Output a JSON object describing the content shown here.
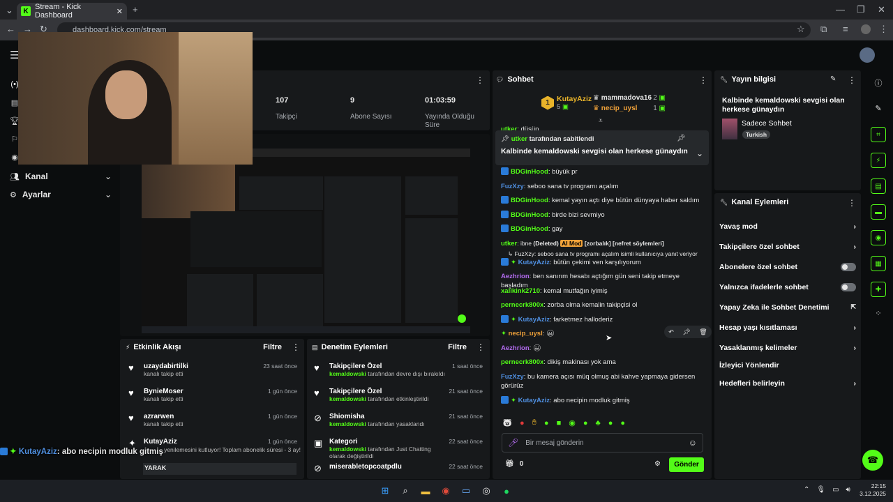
{
  "browser": {
    "tab_title": "Stream - Kick Dashboard",
    "url": "dashboard.kick.com/stream"
  },
  "sidebar": {
    "items": [
      {
        "label": "Kanal"
      },
      {
        "label": "Ayarlar"
      }
    ]
  },
  "stats": [
    {
      "value": "107",
      "label": "Takipçi"
    },
    {
      "value": "9",
      "label": "Abone Sayısı"
    },
    {
      "value": "01:03:59",
      "label": "Yayında Olduğu Süre"
    }
  ],
  "chat": {
    "title": "Sohbet",
    "leaderboard": [
      {
        "rank": "1",
        "name": "KutayAziz",
        "count": "5"
      },
      {
        "name": "mammadova16",
        "count": "2"
      },
      {
        "name": "necip_uysl",
        "count": "1"
      }
    ],
    "partial_user": "utker",
    "partial_text": ": düşüp",
    "pinned_by_user": "utker",
    "pinned_by_suffix": "tarafından sabitlendi",
    "pinned_text": "Kalbinde kemaldowski sevgisi olan herkese günaydın",
    "messages": [
      {
        "user": "BDGinHood",
        "text": ": büyük pr",
        "color": "#53fc18"
      },
      {
        "user": "FuzXzy",
        "text": ": seboo sana tv programı açalım",
        "color": "#4f8fe0"
      },
      {
        "user": "BDGinHood",
        "text": ": kemal yayın açtı diye bütün dünyaya haber saldım",
        "color": "#53fc18"
      },
      {
        "user": "BDGinHood",
        "text": ": birde bizi sevmiyo",
        "color": "#53fc18"
      },
      {
        "user": "BDGinHood",
        "text": ": gay",
        "color": "#53fc18"
      }
    ],
    "moderated": {
      "user": "utker",
      "text": ": ibne",
      "deleted": "(Deleted)",
      "tag": "AI Mod",
      "reasons": "[zorbalık] [nefret söylemleri]"
    },
    "reply_hint": "FuzXzy: seboo sana tv programı açalım isimli kullanıcıya yanıt veriyor",
    "messages2": [
      {
        "user": "KutayAziz",
        "text": ": bütün çekimi ven karşılıyorum",
        "color": "#4f8fe0"
      },
      {
        "user": "Aezhrion",
        "text": ": ben sanırım hesabı açtığım gün seni takip etmeye başladım",
        "color": "#b36cf0"
      },
      {
        "user": "xalikink2710",
        "text": ": kemal mutfağın iyimiş",
        "color": "#53fc18"
      },
      {
        "user": "pernecrk800x",
        "text": ": zorba olma kemalin takipçisi ol",
        "color": "#53fc18"
      },
      {
        "user": "KutayAziz",
        "text": ": farketmez halloderiz",
        "color": "#4f8fe0"
      },
      {
        "user": "necip_uysl",
        "text": ":",
        "color": "#f0a23a"
      },
      {
        "user": "Aezhrion",
        "text": ":",
        "color": "#b36cf0"
      },
      {
        "user": "pernecrk800x",
        "text": ": dikiş makinası yok ama",
        "color": "#53fc18"
      },
      {
        "user": "FuzXzy",
        "text": ": bu kamera açısı müq olmuş abi kahve yapmaya gidersen görürüz",
        "color": "#4f8fe0"
      },
      {
        "user": "KutayAziz",
        "text": ": abo necipin modluk gitmiş",
        "color": "#4f8fe0"
      }
    ],
    "input_placeholder": "Bir mesaj gönderin",
    "points": "0",
    "send_label": "Gönder"
  },
  "stream_info": {
    "title": "Yayın bilgisi",
    "stream_title": "Kalbinde kemaldowski sevgisi olan herkese günaydın",
    "category": "Sadece Sohbet",
    "language": "Turkish"
  },
  "channel_actions": {
    "title": "Kanal Eylemleri",
    "items": [
      {
        "label": "Yavaş mod",
        "control": "chevron"
      },
      {
        "label": "Takipçilere özel sohbet",
        "control": "chevron"
      },
      {
        "label": "Abonelere özel sohbet",
        "control": "toggle"
      },
      {
        "label": "Yalnızca ifadelerle sohbet",
        "control": "toggle"
      },
      {
        "label": "Yapay Zeka ile Sohbet Denetimi",
        "control": "external"
      },
      {
        "label": "Hesap yaşı kısıtlaması",
        "control": "chevron"
      },
      {
        "label": "Yasaklanmış kelimeler",
        "control": "chevron"
      },
      {
        "label": "İzleyici Yönlendir",
        "control": "none"
      },
      {
        "label": "Hedefleri belirleyin",
        "control": "chevron"
      }
    ]
  },
  "activity": {
    "title": "Etkinlik Akışı",
    "filter": "Filtre",
    "rows": [
      {
        "name": "uzaydabirtilki",
        "sub": "kanalı takip etti",
        "time": "23 saat önce"
      },
      {
        "name": "BynieMoser",
        "sub": "kanalı takip etti",
        "time": "1 gün önce"
      },
      {
        "name": "azrarwen",
        "sub": "kanalı takip etti",
        "time": "1 gün önce"
      },
      {
        "name": "KutayAziz",
        "sub": "yenilemesini kutluyor! Toplam abonelik süresi - 3 ay!",
        "time": "1 gün önce"
      }
    ],
    "footer": "YARAK"
  },
  "moderation": {
    "title": "Denetim Eylemleri",
    "filter": "Filtre",
    "rows": [
      {
        "name": "Takipçilere Özel",
        "by": "kemaldowski",
        "action": "tarafından devre dışı bırakıldı",
        "time": "1 saat önce"
      },
      {
        "name": "Takipçilere Özel",
        "by": "kemaldowski",
        "action": "tarafından etkinleştirildi",
        "time": "21 saat önce"
      },
      {
        "name": "Shiomisha",
        "by": "kemaldowski",
        "action": "tarafından yasaklandı",
        "time": "21 saat önce"
      },
      {
        "name": "Kategori",
        "by": "kemaldowski",
        "action": "tarafından Just Chatting olarak değiştirildi",
        "time": "22 saat önce"
      },
      {
        "name": "miserabletopcoatpdlu",
        "by": "",
        "action": "",
        "time": "22 saat önce"
      }
    ]
  },
  "overlay_chat": {
    "user": "KutayAziz",
    "text": ": abo necipin modluk gitmiş"
  },
  "taskbar": {
    "time": "22:15",
    "date": "3.12.2025"
  }
}
